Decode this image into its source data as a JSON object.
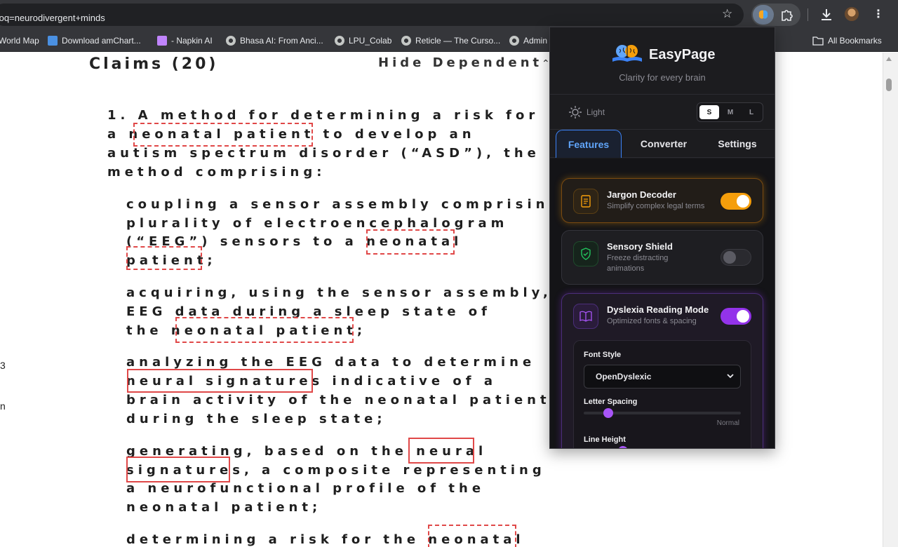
{
  "browser": {
    "url_text": "&oq=neurodivergent+minds",
    "bookmarks": [
      {
        "label": "World Map"
      },
      {
        "label": "Download amChart..."
      },
      {
        "label": "- Napkin AI"
      },
      {
        "label": "Bhasa AI: From Anci..."
      },
      {
        "label": "LPU_Colab"
      },
      {
        "label": "Reticle — The Curso..."
      },
      {
        "label": "Admin"
      }
    ],
    "all_bookmarks_label": "All Bookmarks"
  },
  "page": {
    "claims_title": "Claims (20)",
    "hide_dependent_label": "Hide Dependent",
    "left_fragments": [
      "3",
      "n"
    ],
    "claim_lines": [
      "1. A method for determining a risk for",
      "a neonatal patient to develop an",
      "autism spectrum disorder (“ASD”), the",
      "method comprising:",
      "coupling a sensor assembly comprising",
      "plurality of electroencephalogram",
      "(“EEG”) sensors to a neonatal",
      "patient;",
      "acquiring, using the sensor assembly,",
      "EEG data during a sleep state of",
      "the neonatal patient;",
      "analyzing the EEG data to determine",
      "neural signatures indicative of a",
      "brain activity of the neonatal patient",
      "during the sleep state;",
      "generating, based on the neural",
      "signatures, a composite representing",
      "a neurofunctional profile of the",
      "neonatal patient;",
      "determining a risk for the neonatal"
    ]
  },
  "popup": {
    "title": "EasyPage",
    "tagline": "Clarity for every brain",
    "theme_label": "Light",
    "sizes": [
      "S",
      "M",
      "L"
    ],
    "active_size": "S",
    "tabs": [
      "Features",
      "Converter",
      "Settings"
    ],
    "active_tab": "Features",
    "features": [
      {
        "title": "Jargon Decoder",
        "subtitle": "Simplify complex legal terms",
        "enabled": true,
        "icon": "book-icon",
        "accent": "#f59e0b"
      },
      {
        "title": "Sensory Shield",
        "subtitle": "Freeze distracting animations",
        "enabled": false,
        "icon": "shield-check-icon",
        "accent": "#22c55e"
      },
      {
        "title": "Dyslexia Reading Mode",
        "subtitle": "Optimized fonts & spacing",
        "enabled": true,
        "icon": "open-book-icon",
        "accent": "#9333ea"
      }
    ],
    "dyslexia_settings": {
      "font_style_label": "Font Style",
      "font_style_value": "OpenDyslexic",
      "letter_spacing_label": "Letter Spacing",
      "letter_spacing_value": "Normal",
      "line_height_label": "Line Height"
    }
  }
}
